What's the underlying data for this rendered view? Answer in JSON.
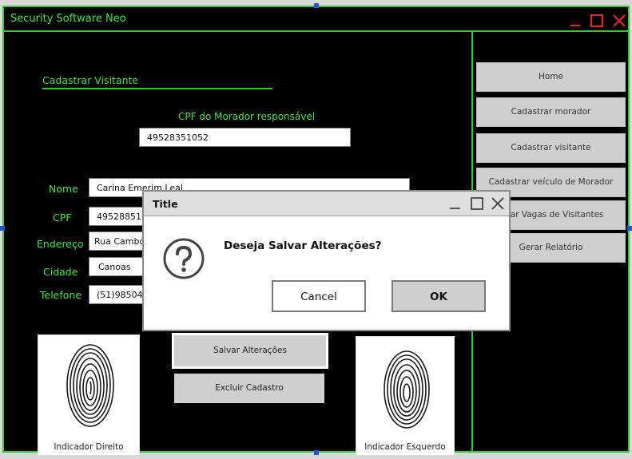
{
  "window": {
    "title": "Security Software Neo"
  },
  "form": {
    "section_title": "Cadastrar Visitante",
    "cpf_resp_label": "CPF do Morador responsável",
    "cpf_resp_value": "49528351052",
    "fields": {
      "nome": {
        "label": "Nome",
        "value": "Carina Emerim Leal"
      },
      "cpf": {
        "label": "CPF",
        "value": "49528851052"
      },
      "endereco": {
        "label": "Endereço",
        "value": "Rua Cambo"
      },
      "cidade": {
        "label": "Cidade",
        "value": "Canoas"
      },
      "telefone": {
        "label": "Telefone",
        "value": "(51)98504-"
      }
    },
    "save_label": "Salvar Alterações",
    "delete_label": "Excluir Cadastro",
    "print_right_caption": "Indicador Direito",
    "print_left_caption": "Indicador Esquerdo"
  },
  "sidebar": {
    "items": [
      {
        "label": "Home"
      },
      {
        "label": "Cadastrar morador"
      },
      {
        "label": "Cadastrar visitante"
      },
      {
        "label": "Cadastrar veículo de Morador"
      },
      {
        "label": "ificar Vagas de Visitantes"
      },
      {
        "label": "Gerar Relatório"
      }
    ]
  },
  "dialog": {
    "title": "Title",
    "message": "Deseja Salvar Alterações?",
    "cancel_label": "Cancel",
    "ok_label": "OK",
    "icon": "question-icon"
  },
  "colors": {
    "accent": "#2ecc2e",
    "background": "#000000",
    "close": "#e0252b"
  }
}
